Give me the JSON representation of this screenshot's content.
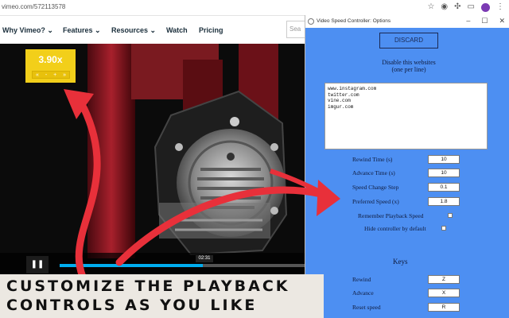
{
  "browser": {
    "url": "vimeo.com/572113578"
  },
  "nav": {
    "items": [
      "Why Vimeo? ⌄",
      "Features ⌄",
      "Resources ⌄",
      "Watch",
      "Pricing"
    ],
    "search_placeholder": "Sea"
  },
  "video": {
    "speed_value": "3.90x",
    "speed_buttons": [
      "«",
      "-",
      "+",
      "»"
    ],
    "timestamp": "02:31",
    "progress": 0.58
  },
  "window": {
    "title": "Video Speed Controller: Options",
    "discard_label": "DISCARD",
    "sites_label_1": "Disable this websites",
    "sites_label_2": "(one per line)",
    "sites": "www.instagram.com\ntwitter.com\nvine.com\nimgur.com",
    "settings": [
      {
        "label": "Rewind Time (s)",
        "value": "10"
      },
      {
        "label": "Advance Time (s)",
        "value": "10"
      },
      {
        "label": "Speed Change Step",
        "value": "0.1"
      },
      {
        "label": "Preferred Speed (x)",
        "value": "1.8"
      }
    ],
    "remember_label": "Remember Playback Speed",
    "hide_label": "Hide controller by default",
    "keys_heading": "Keys",
    "keys": [
      {
        "label": "Rewind",
        "value": "Z"
      },
      {
        "label": "Advance",
        "value": "X"
      },
      {
        "label": "Reset speed",
        "value": "R"
      }
    ]
  },
  "caption": {
    "line1": "CUSTOMIZE THE PLAYBACK",
    "line2": "CONTROLS AS YOU LIKE"
  },
  "colors": {
    "accent_red": "#e8303a",
    "panel_blue": "#4d8ff2",
    "speed_yellow": "#f2cf1a"
  }
}
